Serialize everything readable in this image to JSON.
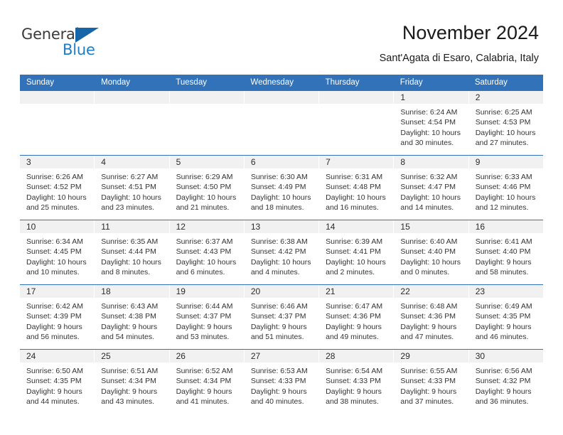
{
  "brand": {
    "name_top": "General",
    "name_bottom": "Blue",
    "accent_color": "#1f7dc4",
    "triangle_color": "#1565a8"
  },
  "header": {
    "title": "November 2024",
    "subtitle": "Sant'Agata di Esaro, Calabria, Italy"
  },
  "calendar": {
    "header_bg": "#3272b8",
    "daynum_bg": "#f1f1f1",
    "weekdays": [
      "Sunday",
      "Monday",
      "Tuesday",
      "Wednesday",
      "Thursday",
      "Friday",
      "Saturday"
    ],
    "weeks": [
      [
        {
          "day": "",
          "sunrise": "",
          "sunset": "",
          "daylight_line1": "",
          "daylight_line2": ""
        },
        {
          "day": "",
          "sunrise": "",
          "sunset": "",
          "daylight_line1": "",
          "daylight_line2": ""
        },
        {
          "day": "",
          "sunrise": "",
          "sunset": "",
          "daylight_line1": "",
          "daylight_line2": ""
        },
        {
          "day": "",
          "sunrise": "",
          "sunset": "",
          "daylight_line1": "",
          "daylight_line2": ""
        },
        {
          "day": "",
          "sunrise": "",
          "sunset": "",
          "daylight_line1": "",
          "daylight_line2": ""
        },
        {
          "day": "1",
          "sunrise": "Sunrise: 6:24 AM",
          "sunset": "Sunset: 4:54 PM",
          "daylight_line1": "Daylight: 10 hours",
          "daylight_line2": "and 30 minutes."
        },
        {
          "day": "2",
          "sunrise": "Sunrise: 6:25 AM",
          "sunset": "Sunset: 4:53 PM",
          "daylight_line1": "Daylight: 10 hours",
          "daylight_line2": "and 27 minutes."
        }
      ],
      [
        {
          "day": "3",
          "sunrise": "Sunrise: 6:26 AM",
          "sunset": "Sunset: 4:52 PM",
          "daylight_line1": "Daylight: 10 hours",
          "daylight_line2": "and 25 minutes."
        },
        {
          "day": "4",
          "sunrise": "Sunrise: 6:27 AM",
          "sunset": "Sunset: 4:51 PM",
          "daylight_line1": "Daylight: 10 hours",
          "daylight_line2": "and 23 minutes."
        },
        {
          "day": "5",
          "sunrise": "Sunrise: 6:29 AM",
          "sunset": "Sunset: 4:50 PM",
          "daylight_line1": "Daylight: 10 hours",
          "daylight_line2": "and 21 minutes."
        },
        {
          "day": "6",
          "sunrise": "Sunrise: 6:30 AM",
          "sunset": "Sunset: 4:49 PM",
          "daylight_line1": "Daylight: 10 hours",
          "daylight_line2": "and 18 minutes."
        },
        {
          "day": "7",
          "sunrise": "Sunrise: 6:31 AM",
          "sunset": "Sunset: 4:48 PM",
          "daylight_line1": "Daylight: 10 hours",
          "daylight_line2": "and 16 minutes."
        },
        {
          "day": "8",
          "sunrise": "Sunrise: 6:32 AM",
          "sunset": "Sunset: 4:47 PM",
          "daylight_line1": "Daylight: 10 hours",
          "daylight_line2": "and 14 minutes."
        },
        {
          "day": "9",
          "sunrise": "Sunrise: 6:33 AM",
          "sunset": "Sunset: 4:46 PM",
          "daylight_line1": "Daylight: 10 hours",
          "daylight_line2": "and 12 minutes."
        }
      ],
      [
        {
          "day": "10",
          "sunrise": "Sunrise: 6:34 AM",
          "sunset": "Sunset: 4:45 PM",
          "daylight_line1": "Daylight: 10 hours",
          "daylight_line2": "and 10 minutes."
        },
        {
          "day": "11",
          "sunrise": "Sunrise: 6:35 AM",
          "sunset": "Sunset: 4:44 PM",
          "daylight_line1": "Daylight: 10 hours",
          "daylight_line2": "and 8 minutes."
        },
        {
          "day": "12",
          "sunrise": "Sunrise: 6:37 AM",
          "sunset": "Sunset: 4:43 PM",
          "daylight_line1": "Daylight: 10 hours",
          "daylight_line2": "and 6 minutes."
        },
        {
          "day": "13",
          "sunrise": "Sunrise: 6:38 AM",
          "sunset": "Sunset: 4:42 PM",
          "daylight_line1": "Daylight: 10 hours",
          "daylight_line2": "and 4 minutes."
        },
        {
          "day": "14",
          "sunrise": "Sunrise: 6:39 AM",
          "sunset": "Sunset: 4:41 PM",
          "daylight_line1": "Daylight: 10 hours",
          "daylight_line2": "and 2 minutes."
        },
        {
          "day": "15",
          "sunrise": "Sunrise: 6:40 AM",
          "sunset": "Sunset: 4:40 PM",
          "daylight_line1": "Daylight: 10 hours",
          "daylight_line2": "and 0 minutes."
        },
        {
          "day": "16",
          "sunrise": "Sunrise: 6:41 AM",
          "sunset": "Sunset: 4:40 PM",
          "daylight_line1": "Daylight: 9 hours",
          "daylight_line2": "and 58 minutes."
        }
      ],
      [
        {
          "day": "17",
          "sunrise": "Sunrise: 6:42 AM",
          "sunset": "Sunset: 4:39 PM",
          "daylight_line1": "Daylight: 9 hours",
          "daylight_line2": "and 56 minutes."
        },
        {
          "day": "18",
          "sunrise": "Sunrise: 6:43 AM",
          "sunset": "Sunset: 4:38 PM",
          "daylight_line1": "Daylight: 9 hours",
          "daylight_line2": "and 54 minutes."
        },
        {
          "day": "19",
          "sunrise": "Sunrise: 6:44 AM",
          "sunset": "Sunset: 4:37 PM",
          "daylight_line1": "Daylight: 9 hours",
          "daylight_line2": "and 53 minutes."
        },
        {
          "day": "20",
          "sunrise": "Sunrise: 6:46 AM",
          "sunset": "Sunset: 4:37 PM",
          "daylight_line1": "Daylight: 9 hours",
          "daylight_line2": "and 51 minutes."
        },
        {
          "day": "21",
          "sunrise": "Sunrise: 6:47 AM",
          "sunset": "Sunset: 4:36 PM",
          "daylight_line1": "Daylight: 9 hours",
          "daylight_line2": "and 49 minutes."
        },
        {
          "day": "22",
          "sunrise": "Sunrise: 6:48 AM",
          "sunset": "Sunset: 4:36 PM",
          "daylight_line1": "Daylight: 9 hours",
          "daylight_line2": "and 47 minutes."
        },
        {
          "day": "23",
          "sunrise": "Sunrise: 6:49 AM",
          "sunset": "Sunset: 4:35 PM",
          "daylight_line1": "Daylight: 9 hours",
          "daylight_line2": "and 46 minutes."
        }
      ],
      [
        {
          "day": "24",
          "sunrise": "Sunrise: 6:50 AM",
          "sunset": "Sunset: 4:35 PM",
          "daylight_line1": "Daylight: 9 hours",
          "daylight_line2": "and 44 minutes."
        },
        {
          "day": "25",
          "sunrise": "Sunrise: 6:51 AM",
          "sunset": "Sunset: 4:34 PM",
          "daylight_line1": "Daylight: 9 hours",
          "daylight_line2": "and 43 minutes."
        },
        {
          "day": "26",
          "sunrise": "Sunrise: 6:52 AM",
          "sunset": "Sunset: 4:34 PM",
          "daylight_line1": "Daylight: 9 hours",
          "daylight_line2": "and 41 minutes."
        },
        {
          "day": "27",
          "sunrise": "Sunrise: 6:53 AM",
          "sunset": "Sunset: 4:33 PM",
          "daylight_line1": "Daylight: 9 hours",
          "daylight_line2": "and 40 minutes."
        },
        {
          "day": "28",
          "sunrise": "Sunrise: 6:54 AM",
          "sunset": "Sunset: 4:33 PM",
          "daylight_line1": "Daylight: 9 hours",
          "daylight_line2": "and 38 minutes."
        },
        {
          "day": "29",
          "sunrise": "Sunrise: 6:55 AM",
          "sunset": "Sunset: 4:33 PM",
          "daylight_line1": "Daylight: 9 hours",
          "daylight_line2": "and 37 minutes."
        },
        {
          "day": "30",
          "sunrise": "Sunrise: 6:56 AM",
          "sunset": "Sunset: 4:32 PM",
          "daylight_line1": "Daylight: 9 hours",
          "daylight_line2": "and 36 minutes."
        }
      ]
    ]
  }
}
